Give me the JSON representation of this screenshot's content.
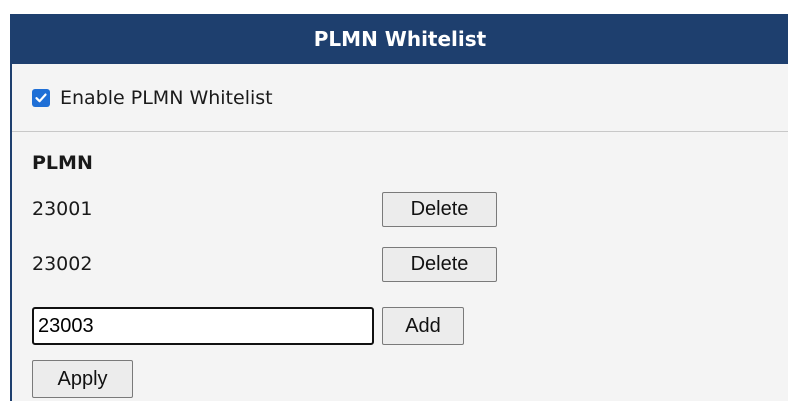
{
  "header": {
    "title": "PLMN Whitelist"
  },
  "enable": {
    "label": "Enable PLMN Whitelist",
    "checked": true
  },
  "list": {
    "column_header": "PLMN",
    "items": [
      {
        "value": "23001",
        "action": "Delete"
      },
      {
        "value": "23002",
        "action": "Delete"
      }
    ]
  },
  "new_entry": {
    "value": "23003",
    "add_label": "Add"
  },
  "apply_label": "Apply",
  "colors": {
    "header_bg": "#1e3f6e",
    "checkbox": "#1f6fd6",
    "panel_bg": "#f4f4f4"
  }
}
